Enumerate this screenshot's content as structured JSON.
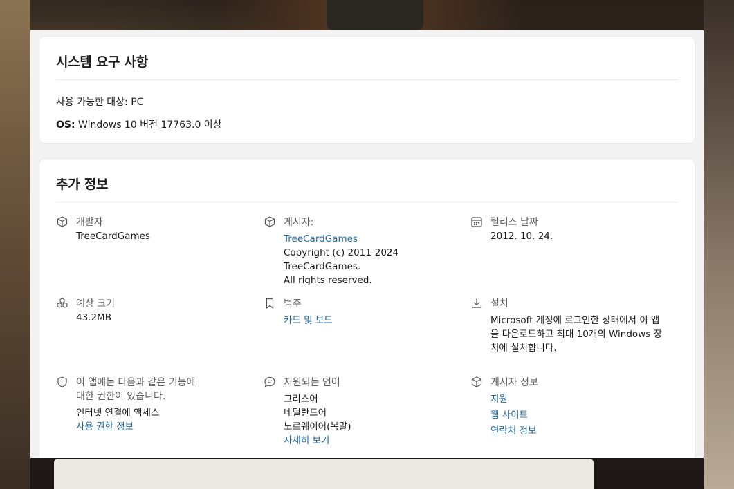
{
  "requirements": {
    "title": "시스템 요구 사항",
    "available_label": "사용 가능한 대상: PC",
    "os_label": "OS:",
    "os_value": " Windows 10 버전 17763.0 이상"
  },
  "info": {
    "title": "추가 정보",
    "developer": {
      "label": "개발자",
      "value": "TreeCardGames",
      "icon": "box-icon"
    },
    "publisher": {
      "label": "게시자:",
      "link": "TreeCardGames",
      "copyright_1": "Copyright (c) 2011-2024 TreeCardGames.",
      "copyright_2": "All rights reserved.",
      "icon": "box-icon"
    },
    "release": {
      "label": "릴리스 날짜",
      "value": "2012. 10. 24.",
      "icon": "calendar-icon"
    },
    "size": {
      "label": "예상 크기",
      "value": "43.2MB",
      "icon": "cubes-icon"
    },
    "category": {
      "label": "범주",
      "link": "카드 및 보드",
      "icon": "bookmark-icon"
    },
    "install": {
      "label": "설치",
      "line_1": "Microsoft 계정에 로그인한 상태에서 이 앱",
      "line_2": "을 다운로드하고 최대 10개의 Windows 장",
      "line_3": "치에 설치합니다.",
      "icon": "download-icon"
    },
    "permissions": {
      "label_1": "이 앱에는 다음과 같은 기능에",
      "label_2": "대한 권한이 있습니다.",
      "value": "인터넷 연결에 액세스",
      "link": "사용 권한 정보",
      "icon": "shield-icon"
    },
    "languages": {
      "label": "지원되는 언어",
      "items": [
        "그리스어",
        "네덜란드어",
        "노르웨이어(복말)"
      ],
      "link": "자세히 보기",
      "icon": "chat-icon"
    },
    "publisher_info": {
      "label": "게시자 정보",
      "links": [
        "지원",
        "웹 사이트",
        "연락처 정보"
      ],
      "icon": "box-icon"
    }
  },
  "colors": {
    "link": "#1f6aa5",
    "panel_bg": "#f3f3f3",
    "card_bg": "#ffffff"
  }
}
